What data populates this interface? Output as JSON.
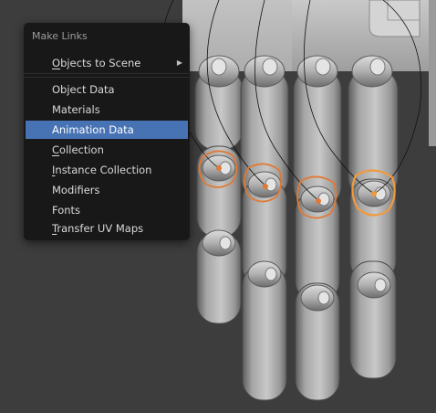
{
  "colors": {
    "menu_bg": "#181818",
    "highlight": "#4772b3",
    "viewport_bg": "#3d3d3d",
    "selected_outline": "#e07a35",
    "active_outline": "#f19a3c"
  },
  "menu": {
    "title": "Make Links",
    "items": [
      {
        "u": "O",
        "rest": "bjects to Scene",
        "submenu": true
      },
      {
        "u": "",
        "rest": "Object Data"
      },
      {
        "u": "",
        "rest": "Materials"
      },
      {
        "u": "",
        "rest": "Animation Data",
        "active": true
      },
      {
        "u": "C",
        "rest": "ollection"
      },
      {
        "u": "I",
        "rest": "nstance Collection"
      },
      {
        "u": "",
        "rest": "Modifiers"
      },
      {
        "u": "",
        "rest": "Fonts"
      },
      {
        "u": "T",
        "rest": "ransfer UV Maps"
      }
    ]
  },
  "icons": {
    "submenu": "chevron-right-icon"
  }
}
